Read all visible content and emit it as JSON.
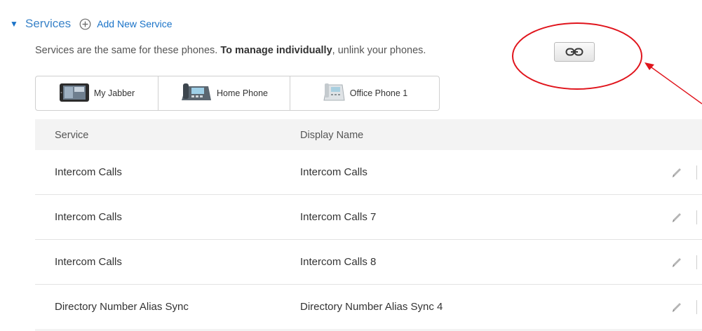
{
  "section": {
    "title": "Services",
    "add_label": "Add New Service",
    "description_prefix": "Services are the same for these phones. ",
    "description_bold": "To manage individually",
    "description_suffix": ", unlink your phones."
  },
  "phones": [
    {
      "label": "My Jabber",
      "icon": "jabber-tablet-icon"
    },
    {
      "label": "Home Phone",
      "icon": "desk-phone-icon"
    },
    {
      "label": "Office Phone 1",
      "icon": "office-phone-icon"
    }
  ],
  "table": {
    "headers": {
      "service": "Service",
      "display_name": "Display Name"
    },
    "rows": [
      {
        "service": "Intercom Calls",
        "display_name": "Intercom Calls"
      },
      {
        "service": "Intercom Calls",
        "display_name": "Intercom Calls 7"
      },
      {
        "service": "Intercom Calls",
        "display_name": "Intercom Calls 8"
      },
      {
        "service": "Directory Number Alias Sync",
        "display_name": "Directory Number Alias Sync 4"
      }
    ]
  },
  "icons": {
    "toggle": "triangle-down-icon",
    "add": "plus-circle-icon",
    "link": "chain-link-icon",
    "edit": "pencil-icon"
  },
  "colors": {
    "accent": "#1a73c8",
    "annotation": "#e0141c",
    "header_bg": "#f3f3f3"
  }
}
